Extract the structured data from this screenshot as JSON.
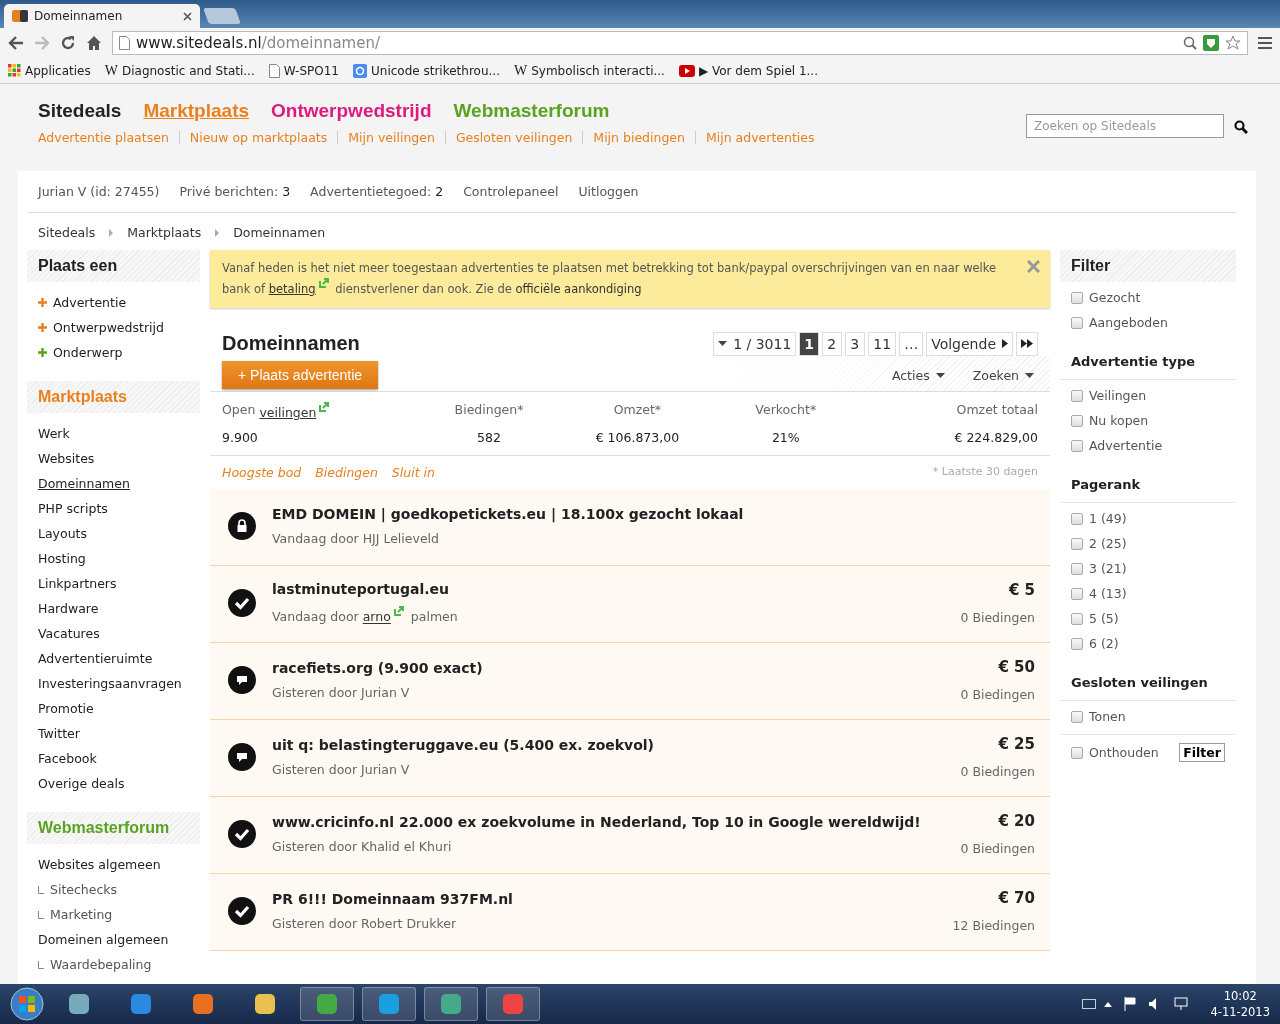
{
  "browser": {
    "tab_title": "Domeinnamen",
    "url_host": "www.sitedeals.nl",
    "url_path": "/domeinnamen/",
    "bookmarks": [
      {
        "kind": "apps",
        "label": "Applicaties"
      },
      {
        "kind": "wiki",
        "icon": "W",
        "label": "Diagnostic and Stati..."
      },
      {
        "kind": "page",
        "label": "W-SPO11"
      },
      {
        "kind": "google",
        "label": "Unicode strikethrou..."
      },
      {
        "kind": "wiki",
        "icon": "W",
        "label": "Symbolisch interacti..."
      },
      {
        "kind": "video",
        "label": "▶ Vor dem Spiel 1..."
      }
    ]
  },
  "header": {
    "brand": "Sitedeals",
    "sections": [
      {
        "label": "Marktplaats",
        "color": "#e8801e",
        "selected": true
      },
      {
        "label": "Ontwerpwedstrijd",
        "color": "#e0197d",
        "selected": false
      },
      {
        "label": "Webmasterforum",
        "color": "#5aa320",
        "selected": false
      }
    ],
    "links": [
      "Advertentie plaatsen",
      "Nieuw op marktplaats",
      "Mijn veilingen",
      "Gesloten veilingen",
      "Mijn biedingen",
      "Mijn advertenties"
    ],
    "search": {
      "placeholder": "Zoeken op Sitedeals"
    }
  },
  "userbar": [
    {
      "label": "Jurian V (id: 27455)"
    },
    {
      "label": "Privé berichten:",
      "value": "3"
    },
    {
      "label": "Advertentietegoed:",
      "value": "2"
    },
    {
      "label": "Controlepaneel"
    },
    {
      "label": "Uitloggen"
    }
  ],
  "breadcrumbs": [
    "Sitedeals",
    "Marktplaats",
    "Domeinnamen"
  ],
  "sidebar": {
    "sections": [
      {
        "title": "Plaats een",
        "color": "#222222",
        "items": [
          {
            "label": "Advertentie",
            "color": "#e8801e"
          },
          {
            "label": "Ontwerpwedstrijd",
            "color": "#e8801e"
          },
          {
            "label": "Onderwerp",
            "color": "#5aa320"
          }
        ]
      },
      {
        "title": "Marktplaats",
        "color": "#e8801e",
        "items": [
          {
            "label": "Werk",
            "selected": false
          },
          {
            "label": "Websites",
            "selected": false
          },
          {
            "label": "Domeinnamen",
            "selected": true
          },
          {
            "label": "PHP scripts",
            "selected": false
          },
          {
            "label": "Layouts",
            "selected": false
          },
          {
            "label": "Hosting",
            "selected": false
          },
          {
            "label": "Linkpartners",
            "selected": false
          },
          {
            "label": "Hardware",
            "selected": false
          },
          {
            "label": "Vacatures",
            "selected": false
          },
          {
            "label": "Advertentieruimte",
            "selected": false
          },
          {
            "label": "Investeringsaanvragen",
            "selected": false
          },
          {
            "label": "Promotie",
            "selected": false
          },
          {
            "label": "Twitter",
            "selected": false
          },
          {
            "label": "Facebook",
            "selected": false
          },
          {
            "label": "Overige deals",
            "selected": false
          }
        ]
      },
      {
        "title": "Webmasterforum",
        "color": "#5aa320",
        "items": [
          {
            "label": "Websites algemeen",
            "children": [
              {
                "label": "Sitechecks"
              },
              {
                "label": "Marketing"
              }
            ]
          },
          {
            "label": "Domeinen algemeen",
            "children": [
              {
                "label": "Waardebepaling"
              }
            ]
          }
        ]
      }
    ]
  },
  "notice": {
    "text_1": "Vanaf heden is het niet meer toegestaan advertenties te plaatsen met betrekking tot bank/paypal overschrijvingen van en naar welke bank of",
    "link": "betaling",
    "text_2": "dienstverlener dan ook. Zie de",
    "link_2": "officiële aankondiging"
  },
  "listing": {
    "title": "Domeinnamen",
    "page_select": "1 / 3011",
    "pages": [
      {
        "label": "1",
        "selected": true
      },
      {
        "label": "2",
        "selected": false
      },
      {
        "label": "3",
        "selected": false
      },
      {
        "label": "11",
        "selected": false
      }
    ],
    "ellipsis": "…",
    "next": "Volgende",
    "add_button": "+ Plaats advertentie",
    "menus": [
      "Acties",
      "Zoeken"
    ],
    "stats": [
      {
        "label": "Open",
        "link": "veilingen",
        "value": "9.900"
      },
      {
        "label": "Biedingen*",
        "value": "582"
      },
      {
        "label": "Omzet*",
        "value": "€ 106.873,00"
      },
      {
        "label": "Verkocht*",
        "value": "21%"
      },
      {
        "label": "Omzet totaal",
        "value": "€ 224.829,00"
      }
    ],
    "sort_links": [
      "Hoogste bod",
      "Biedingen",
      "Sluit in"
    ],
    "note": "* Laatste 30 dagen",
    "items": [
      {
        "kind": "locked",
        "title": "EMD DOMEIN | goedkopetickets.eu | 18.100x gezocht lokaal",
        "prefix": "Vandaag door",
        "author": "HJJ Lelieveld",
        "linked": false
      },
      {
        "kind": "check",
        "title": "lastminuteportugal.eu",
        "prefix": "Vandaag door",
        "author": "arno",
        "linked": true,
        "suffix": "palmen",
        "price": "€ 5",
        "bids": "0 Biedingen"
      },
      {
        "kind": "chat",
        "title": "racefiets.org (9.900 exact)",
        "prefix": "Gisteren door",
        "author": "Jurian V",
        "linked": false,
        "price": "€ 50",
        "bids": "0 Biedingen"
      },
      {
        "kind": "chat",
        "title": "uit q: belastingteruggave.eu (5.400 ex. zoekvol)",
        "prefix": "Gisteren door",
        "author": "Jurian V",
        "linked": false,
        "price": "€ 25",
        "bids": "0 Biedingen"
      },
      {
        "kind": "check",
        "title": "www.cricinfo.nl 22.000 ex zoekvolume in Nederland, Top 10 in Google wereldwijd!",
        "prefix": "Gisteren door",
        "author": "Khalid el Khuri",
        "linked": false,
        "price": "€ 20",
        "bids": "0 Biedingen"
      },
      {
        "kind": "check",
        "title": "PR 6!!! Domeinnaam 937FM.nl",
        "prefix": "Gisteren door",
        "author": "Robert Drukker",
        "linked": false,
        "price": "€ 70",
        "bids": "12 Biedingen"
      }
    ]
  },
  "filter": {
    "title": "Filter",
    "groups": [
      {
        "options": [
          {
            "label": "Gezocht",
            "checked": false
          },
          {
            "label": "Aangeboden",
            "checked": false
          }
        ]
      },
      {
        "heading": "Advertentie type",
        "options": [
          {
            "label": "Veilingen",
            "checked": false
          },
          {
            "label": "Nu kopen",
            "checked": false
          },
          {
            "label": "Advertentie",
            "checked": false
          }
        ]
      },
      {
        "heading": "Pagerank",
        "options": [
          {
            "label": "1 (49)",
            "checked": false
          },
          {
            "label": "2 (25)",
            "checked": false
          },
          {
            "label": "3 (21)",
            "checked": false
          },
          {
            "label": "4 (13)",
            "checked": false
          },
          {
            "label": "5 (5)",
            "checked": false
          },
          {
            "label": "6 (2)",
            "checked": false
          }
        ]
      },
      {
        "heading": "Gesloten veilingen",
        "options": [
          {
            "label": "Tonen",
            "checked": false
          }
        ]
      }
    ],
    "remember": {
      "label": "Onthouden",
      "checked": false
    },
    "button": "Filter"
  },
  "taskbar": {
    "time": "10:02",
    "date": "4-11-2013"
  }
}
